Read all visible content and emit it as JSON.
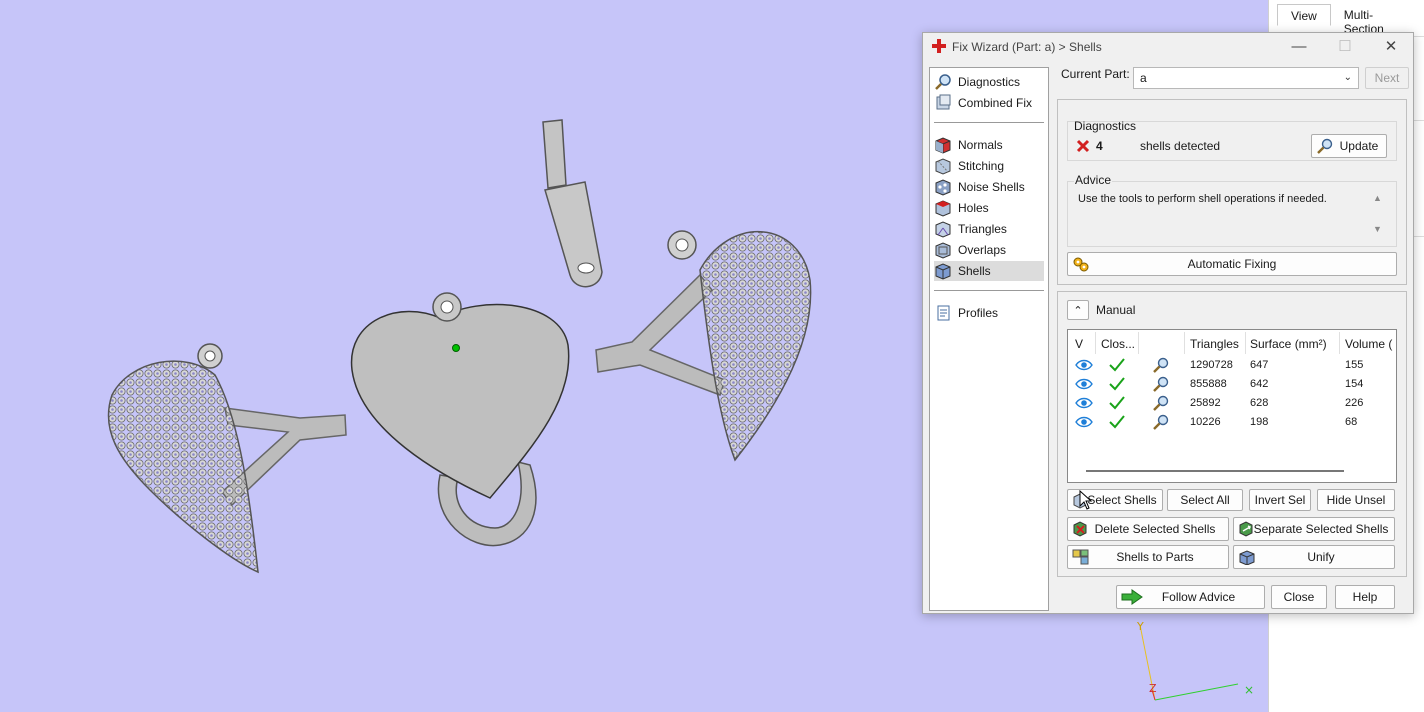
{
  "right_panel": {
    "tabs": [
      "View",
      "Multi-Section"
    ]
  },
  "dialog": {
    "title": "Fix Wizard (Part: a) > Shells",
    "nav": {
      "top_items": [
        {
          "label": "Diagnostics",
          "icon": "magnifier-icon"
        },
        {
          "label": "Combined Fix",
          "icon": "combined-fix-icon"
        }
      ],
      "fix_items": [
        {
          "label": "Normals",
          "icon": "normals-icon"
        },
        {
          "label": "Stitching",
          "icon": "stitching-icon"
        },
        {
          "label": "Noise Shells",
          "icon": "noise-shells-icon"
        },
        {
          "label": "Holes",
          "icon": "holes-icon"
        },
        {
          "label": "Triangles",
          "icon": "triangles-icon"
        },
        {
          "label": "Overlaps",
          "icon": "overlaps-icon"
        },
        {
          "label": "Shells",
          "icon": "shells-icon"
        }
      ],
      "bottom_items": [
        {
          "label": "Profiles",
          "icon": "profiles-icon"
        }
      ],
      "active": "Shells"
    },
    "current_part_label": "Current Part:",
    "current_part_value": "a",
    "next_label": "Next",
    "diagnostics": {
      "heading": "Diagnostics",
      "count": "4",
      "text": "shells detected",
      "update_label": "Update"
    },
    "advice": {
      "heading": "Advice",
      "text": "Use the tools to perform shell operations if needed."
    },
    "automatic_fixing_label": "Automatic Fixing",
    "manual": {
      "label": "Manual",
      "columns": [
        "V",
        "Clos...",
        "",
        "Triangles",
        "Surface (mm²)",
        "Volume ("
      ],
      "rows": [
        {
          "triangles": "1290728",
          "surface": "647",
          "volume": "155"
        },
        {
          "triangles": "855888",
          "surface": "642",
          "volume": "154"
        },
        {
          "triangles": "25892",
          "surface": "628",
          "volume": "226"
        },
        {
          "triangles": "10226",
          "surface": "198",
          "volume": "68"
        }
      ],
      "buttons": {
        "select_shells": "Select Shells",
        "select_all": "Select All",
        "invert_sel": "Invert Sel",
        "hide_unsel": "Hide Unsel",
        "delete_selected": "Delete Selected Shells",
        "separate_selected": "Separate Selected Shells",
        "shells_to_parts": "Shells to Parts",
        "unify": "Unify"
      }
    },
    "footer": {
      "follow_advice": "Follow Advice",
      "close": "Close",
      "help": "Help"
    }
  },
  "colors": {
    "viewport_bg": "#c6c5f9",
    "model_gray": "#bdbdbd",
    "accent_red": "#d22020",
    "check_green": "#1aa31a",
    "eye_blue": "#1f7fd8"
  }
}
